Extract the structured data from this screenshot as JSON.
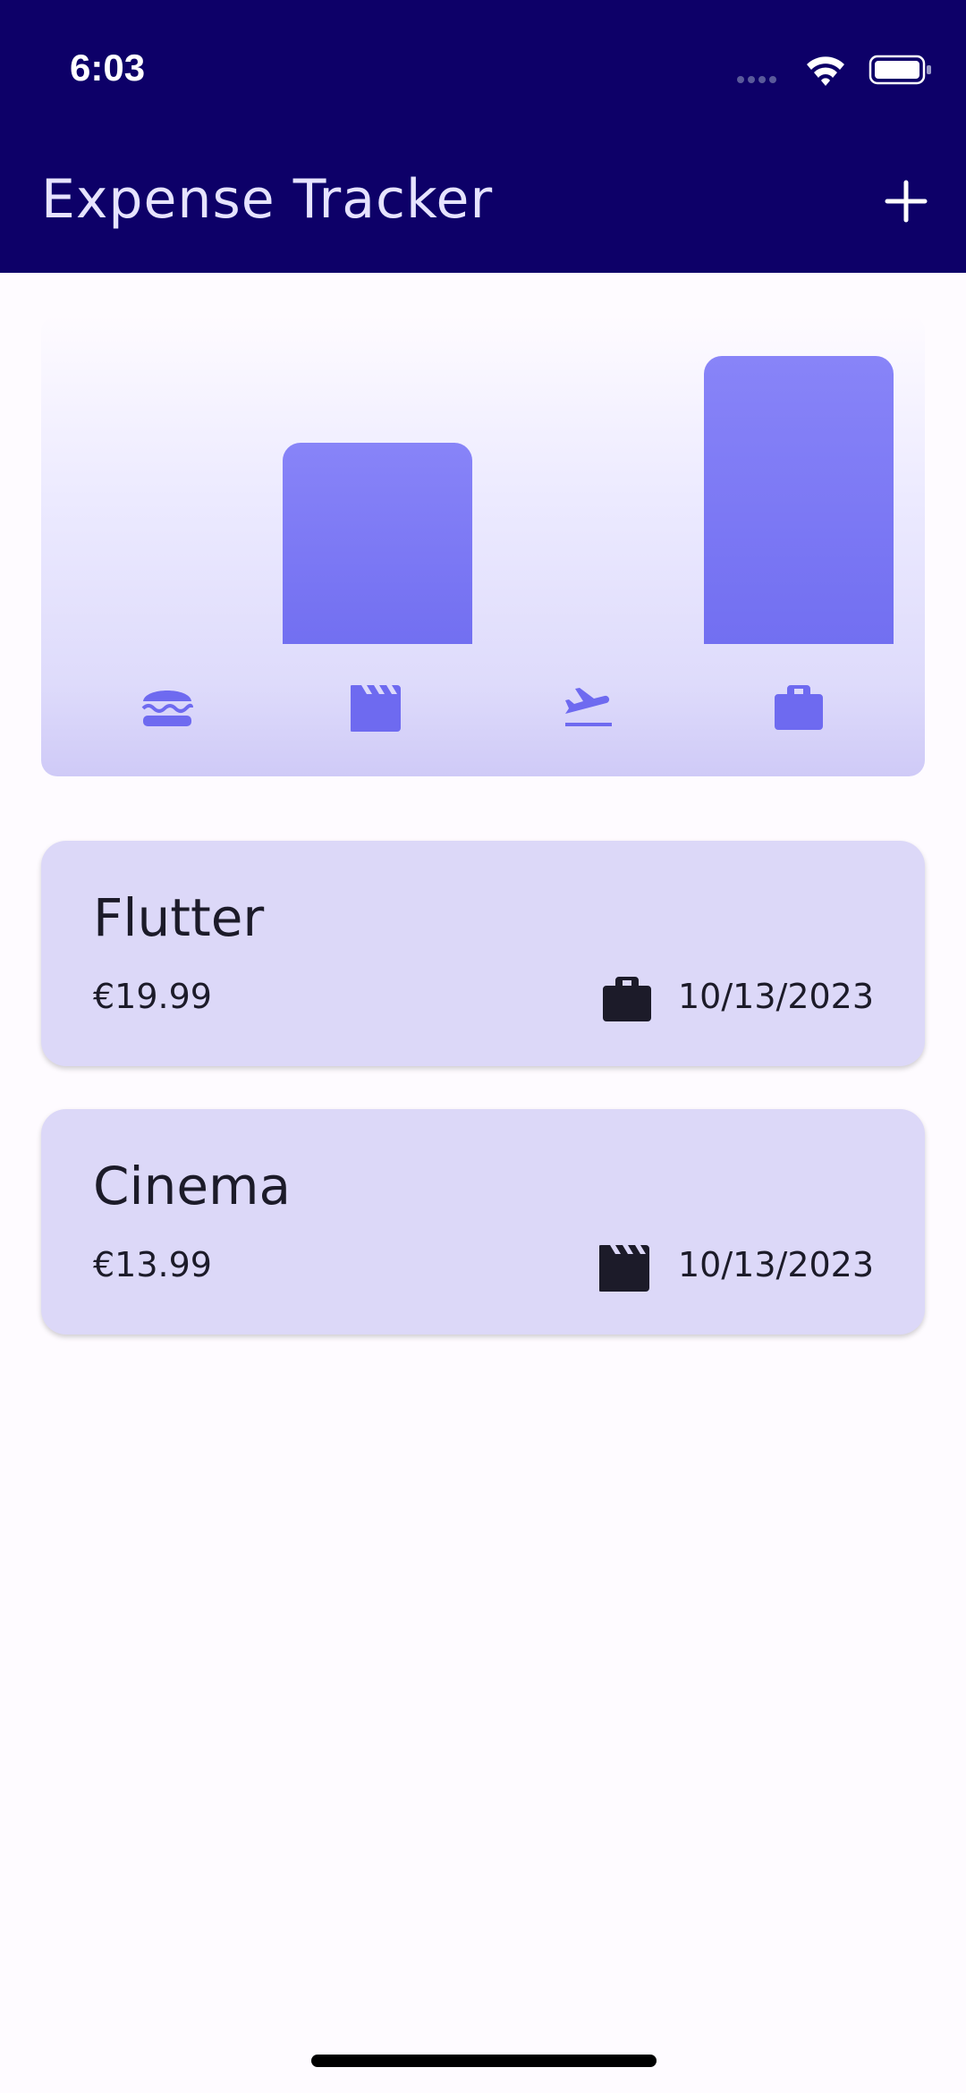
{
  "status_bar": {
    "time": "6:03",
    "icons": [
      "signal-dots-icon",
      "wifi-icon",
      "battery-icon"
    ]
  },
  "app_bar": {
    "title": "Expense Tracker",
    "action_icon": "add-icon"
  },
  "chart": {
    "type": "bar",
    "categories": [
      "food",
      "leisure",
      "travel",
      "work"
    ],
    "category_icons": [
      "burger-icon",
      "clapperboard-icon",
      "flight-takeoff-icon",
      "briefcase-icon"
    ],
    "values": [
      0,
      13.99,
      0,
      19.99
    ],
    "bar_color": "#7a77f4"
  },
  "expenses": [
    {
      "title": "Flutter",
      "amount": "€19.99",
      "category_icon": "briefcase-icon",
      "date": "10/13/2023"
    },
    {
      "title": "Cinema",
      "amount": "€13.99",
      "category_icon": "clapperboard-icon",
      "date": "10/13/2023"
    }
  ],
  "colors": {
    "app_bar": "#0d0068",
    "card": "#dcd8f8",
    "chart_icon": "#6e6af0",
    "background": "#fefbff"
  }
}
